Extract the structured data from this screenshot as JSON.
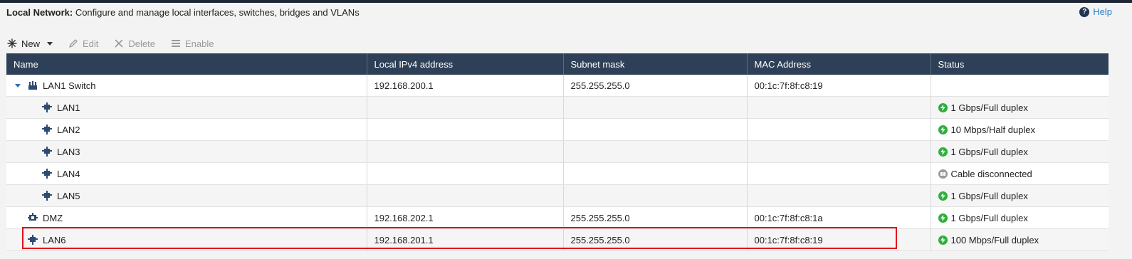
{
  "header": {
    "title_bold": "Local Network:",
    "title_rest": "Configure and manage local interfaces, switches, bridges and VLANs",
    "help_label": "Help"
  },
  "toolbar": {
    "new_label": "New",
    "edit_label": "Edit",
    "delete_label": "Delete",
    "enable_label": "Enable"
  },
  "table": {
    "columns": [
      "Name",
      "Local IPv4 address",
      "Subnet mask",
      "MAC Address",
      "Status"
    ],
    "rows": [
      {
        "name": "LAN1 Switch",
        "ip": "192.168.200.1",
        "mask": "255.255.255.0",
        "mac": "00:1c:7f:8f:c8:19",
        "status": "",
        "status_type": "none",
        "icon": "switch-icon",
        "level": 0,
        "expandable": true
      },
      {
        "name": "LAN1",
        "ip": "",
        "mask": "",
        "mac": "",
        "status": "1 Gbps/Full duplex",
        "status_type": "ok",
        "icon": "ethernet-port-icon",
        "level": 1
      },
      {
        "name": "LAN2",
        "ip": "",
        "mask": "",
        "mac": "",
        "status": "10 Mbps/Half duplex",
        "status_type": "ok",
        "icon": "ethernet-port-icon",
        "level": 1
      },
      {
        "name": "LAN3",
        "ip": "",
        "mask": "",
        "mac": "",
        "status": "1 Gbps/Full duplex",
        "status_type": "ok",
        "icon": "ethernet-port-icon",
        "level": 1
      },
      {
        "name": "LAN4",
        "ip": "",
        "mask": "",
        "mac": "",
        "status": "Cable disconnected",
        "status_type": "disconnected",
        "icon": "ethernet-port-icon",
        "level": 1
      },
      {
        "name": "LAN5",
        "ip": "",
        "mask": "",
        "mac": "",
        "status": "1 Gbps/Full duplex",
        "status_type": "ok",
        "icon": "ethernet-port-icon",
        "level": 1
      },
      {
        "name": "DMZ",
        "ip": "192.168.202.1",
        "mask": "255.255.255.0",
        "mac": "00:1c:7f:8f:c8:1a",
        "status": "1 Gbps/Full duplex",
        "status_type": "ok",
        "icon": "dmz-port-icon",
        "level": 0
      },
      {
        "name": "LAN6",
        "ip": "192.168.201.1",
        "mask": "255.255.255.0",
        "mac": "00:1c:7f:8f:c8:19",
        "status": "100 Mbps/Full duplex",
        "status_type": "ok",
        "icon": "ethernet-port-icon",
        "level": 0,
        "highlighted": true
      }
    ]
  },
  "colors": {
    "header_bg": "#2e4057",
    "status_ok": "#2fae3a",
    "status_disconnected": "#9b9b9b",
    "highlight_border": "#e0101a",
    "link": "#2a7fc7"
  }
}
